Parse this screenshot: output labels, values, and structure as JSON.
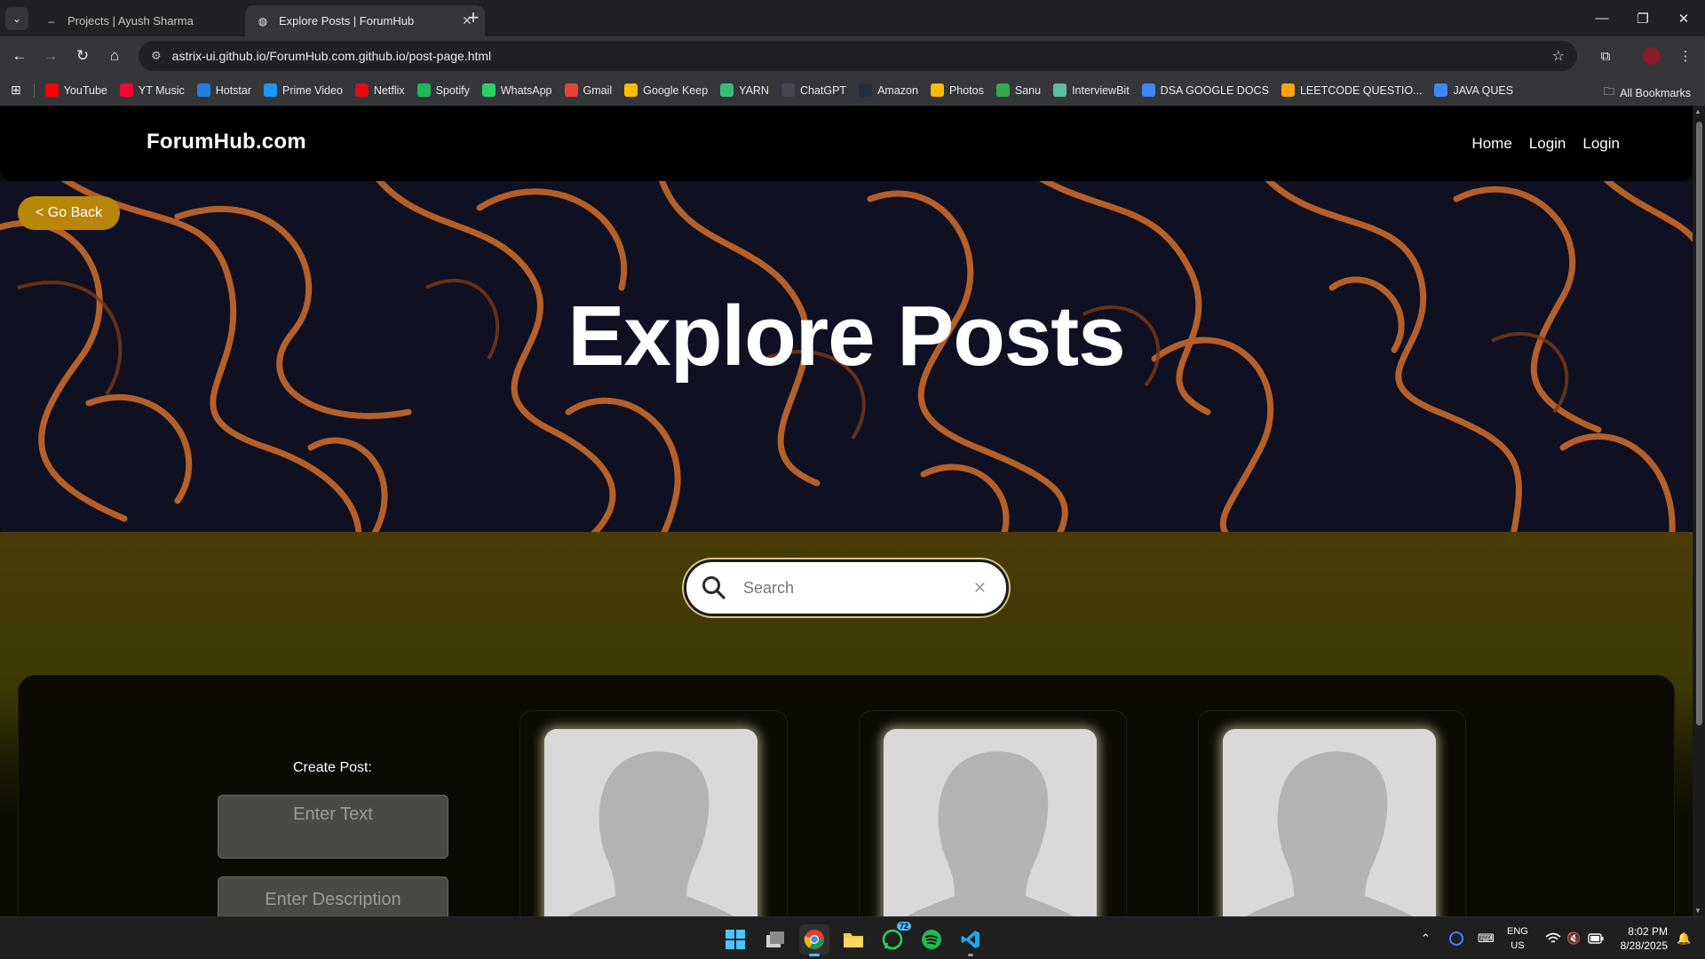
{
  "browser": {
    "tabs": [
      {
        "title": "Projects | Ayush Sharma",
        "active": false
      },
      {
        "title": "Explore Posts | ForumHub",
        "active": true
      }
    ],
    "url": "astrix-ui.github.io/ForumHub.com.github.io/post-page.html",
    "bookmarks": [
      {
        "label": "YouTube",
        "icon": "youtube-icon",
        "color": "#ff0000"
      },
      {
        "label": "YT Music",
        "icon": "yt-music-icon",
        "color": "#ff0033"
      },
      {
        "label": "Hotstar",
        "icon": "hotstar-icon",
        "color": "#1f80e0"
      },
      {
        "label": "Prime Video",
        "icon": "prime-video-icon",
        "color": "#1a98ff"
      },
      {
        "label": "Netflix",
        "icon": "netflix-icon",
        "color": "#e50914"
      },
      {
        "label": "Spotify",
        "icon": "spotify-icon",
        "color": "#1db954"
      },
      {
        "label": "WhatsApp",
        "icon": "whatsapp-icon",
        "color": "#25d366"
      },
      {
        "label": "Gmail",
        "icon": "gmail-icon",
        "color": "#ea4335"
      },
      {
        "label": "Google Keep",
        "icon": "google-keep-icon",
        "color": "#fbbc04"
      },
      {
        "label": "YARN",
        "icon": "yarn-icon",
        "color": "#3ebd78"
      },
      {
        "label": "ChatGPT",
        "icon": "chatgpt-icon",
        "color": "#444654"
      },
      {
        "label": "Amazon",
        "icon": "amazon-icon",
        "color": "#232f3e"
      },
      {
        "label": "Photos",
        "icon": "photos-icon",
        "color": "#fbbc04"
      },
      {
        "label": "Sanu",
        "icon": "sanu-icon",
        "color": "#34a853"
      },
      {
        "label": "InterviewBit",
        "icon": "interviewbit-icon",
        "color": "#5dbea3"
      },
      {
        "label": "DSA GOOGLE DOCS",
        "icon": "google-docs-icon",
        "color": "#4285f4"
      },
      {
        "label": "LEETCODE QUESTIO...",
        "icon": "leetcode-icon",
        "color": "#ffa116"
      },
      {
        "label": "JAVA QUES",
        "icon": "google-docs-icon",
        "color": "#4285f4"
      }
    ],
    "all_bookmarks_label": "All Bookmarks"
  },
  "site": {
    "brand": "ForumHub.com",
    "nav": [
      "Home",
      "Login",
      "Login"
    ],
    "go_back": "< Go Back",
    "hero_title": "Explore Posts",
    "search_placeholder": "Search",
    "create_post_label": "Create Post:",
    "enter_text_placeholder": "Enter Text",
    "enter_description_placeholder": "Enter Description",
    "post_cards": 3,
    "accent_color": "#b8860b"
  },
  "taskbar": {
    "whatsapp_badge": "72",
    "lang": "ENG",
    "region": "US",
    "time": "8:02 PM",
    "date": "8/28/2025"
  }
}
